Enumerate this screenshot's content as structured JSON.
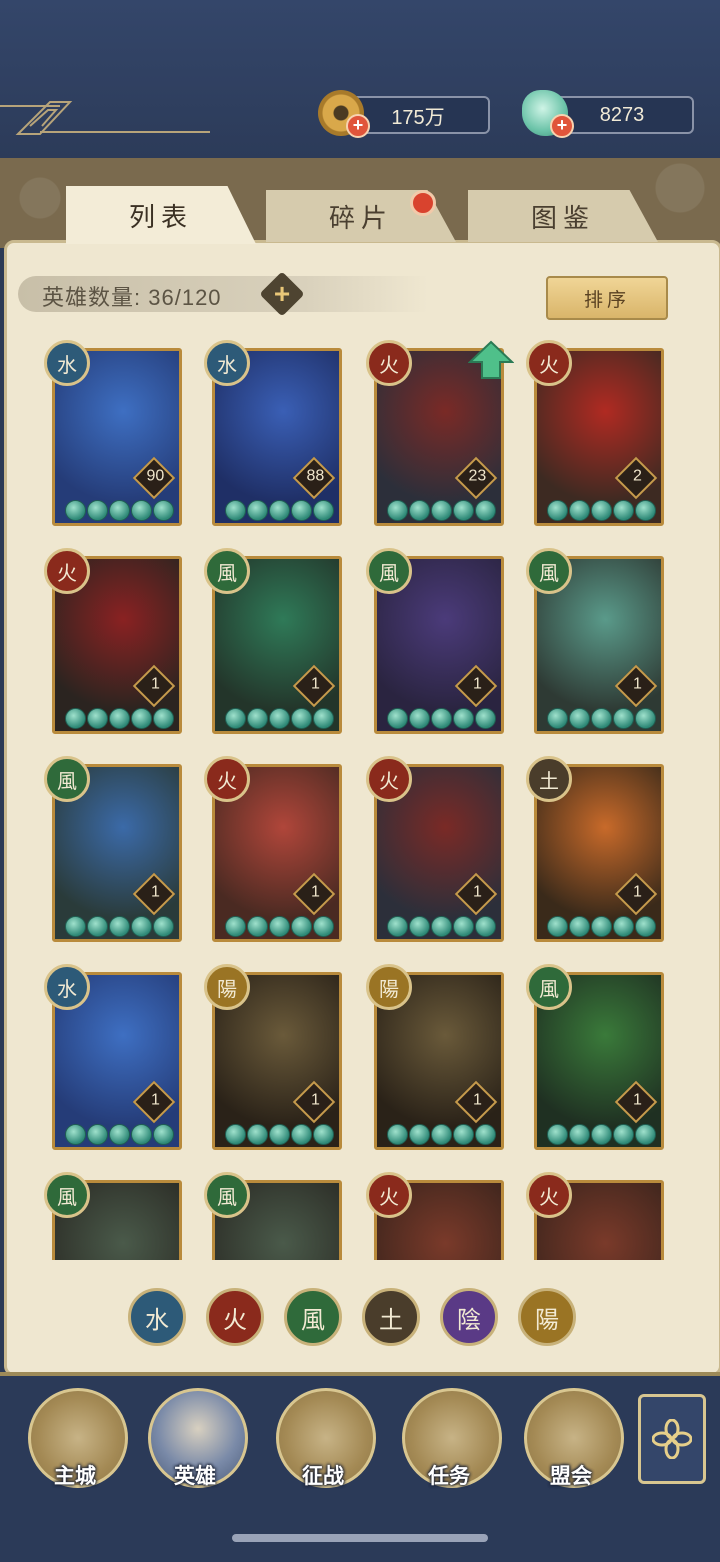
{
  "currencies": [
    {
      "name": "copper-coin",
      "value": "175万"
    },
    {
      "name": "jade",
      "value": "8273"
    }
  ],
  "tabs": [
    {
      "label": "列表",
      "active": true
    },
    {
      "label": "碎片",
      "active": false,
      "notify": true
    },
    {
      "label": "图鉴",
      "active": false
    }
  ],
  "hero_count": {
    "label": "英雄数量:",
    "value": "36/120",
    "add_icon": "+"
  },
  "sort_label": "排序",
  "elements": {
    "water": {
      "glyph": "水",
      "color": "#2d5a78"
    },
    "fire": {
      "glyph": "火",
      "color": "#8a2a1c"
    },
    "wind": {
      "glyph": "風",
      "color": "#2f6a3a"
    },
    "earth": {
      "glyph": "土",
      "color": "#4a3d2b"
    },
    "yin": {
      "glyph": "陰",
      "color": "#5a3a86"
    },
    "yang": {
      "glyph": "陽",
      "color": "#9a7424"
    }
  },
  "heroes": [
    {
      "element": "water",
      "level": "90",
      "art": [
        "#3e6fc2",
        "#253c78"
      ]
    },
    {
      "element": "water",
      "level": "88",
      "art": [
        "#3a5fb5",
        "#1f2f66"
      ]
    },
    {
      "element": "fire",
      "level": "23",
      "art": [
        "#7a2a26",
        "#2c2f3a"
      ],
      "upgrade": true
    },
    {
      "element": "fire",
      "level": "2",
      "art": [
        "#b02a22",
        "#3d2a22"
      ]
    },
    {
      "element": "fire",
      "level": "1",
      "art": [
        "#8a2222",
        "#2b2420"
      ]
    },
    {
      "element": "wind",
      "level": "1",
      "art": [
        "#2f7a58",
        "#23352a"
      ]
    },
    {
      "element": "wind",
      "level": "1",
      "art": [
        "#4b3b7a",
        "#2a2440"
      ]
    },
    {
      "element": "wind",
      "level": "1",
      "art": [
        "#5a9a8a",
        "#2e3a34"
      ]
    },
    {
      "element": "wind",
      "level": "1",
      "art": [
        "#3b6aa8",
        "#2a3b3a"
      ]
    },
    {
      "element": "fire",
      "level": "1",
      "art": [
        "#b0463a",
        "#4a2a22"
      ]
    },
    {
      "element": "fire",
      "level": "1",
      "art": [
        "#7a2a26",
        "#2c2f3a"
      ]
    },
    {
      "element": "earth",
      "level": "1",
      "art": [
        "#c86a2a",
        "#3a2a1a"
      ]
    },
    {
      "element": "water",
      "level": "1",
      "art": [
        "#3e6fc2",
        "#253c78"
      ]
    },
    {
      "element": "yang",
      "level": "1",
      "art": [
        "#6a5a3a",
        "#2a2218"
      ]
    },
    {
      "element": "yang",
      "level": "1",
      "art": [
        "#6a5a3a",
        "#2a2218"
      ]
    },
    {
      "element": "wind",
      "level": "1",
      "art": [
        "#3a7a3a",
        "#1f3022"
      ]
    },
    {
      "element": "wind",
      "level": "",
      "art": [
        "#4a5a4a",
        "#2a2a24"
      ]
    },
    {
      "element": "wind",
      "level": "",
      "art": [
        "#4a5a4a",
        "#2a2a24"
      ]
    },
    {
      "element": "fire",
      "level": "",
      "art": [
        "#7a3a2a",
        "#3a241c"
      ]
    },
    {
      "element": "fire",
      "level": "",
      "art": [
        "#7a3a2a",
        "#3a241c"
      ]
    }
  ],
  "filters": [
    "water",
    "fire",
    "wind",
    "earth",
    "yin",
    "yang"
  ],
  "nav": [
    {
      "label": "主城",
      "icon": "palace-icon"
    },
    {
      "label": "英雄",
      "icon": "hero-portrait-icon"
    },
    {
      "label": "征战",
      "icon": "war-drum-icon"
    },
    {
      "label": "任务",
      "icon": "scroll-icon"
    },
    {
      "label": "盟会",
      "icon": "alliance-icon"
    }
  ],
  "more_icon": "flower-menu-icon"
}
